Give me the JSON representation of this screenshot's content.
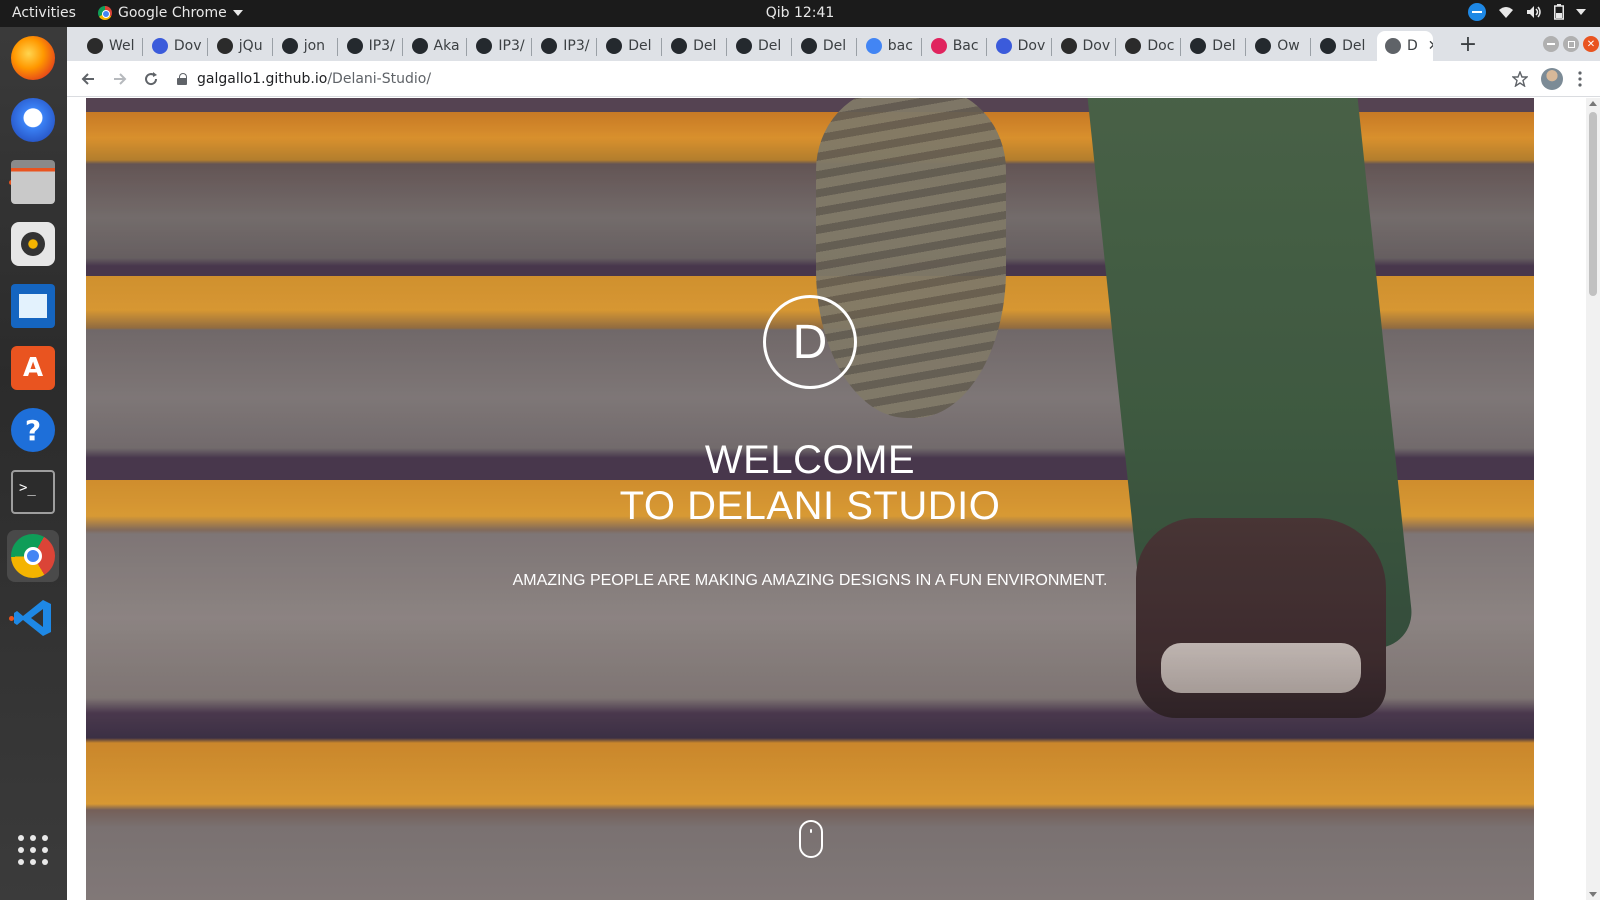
{
  "system": {
    "activities": "Activities",
    "app_menu": "Google Chrome",
    "clock": "Qib 12:41"
  },
  "dock": {
    "apps": [
      "firefox-icon",
      "thunderbird-icon",
      "files-icon",
      "rhythmbox-icon",
      "writer-icon",
      "software-center-icon",
      "help-icon",
      "terminal-icon",
      "chrome-icon",
      "vscode-icon",
      "show-apps-icon"
    ]
  },
  "tabs": [
    {
      "label": "Wel",
      "favicon": "#2b2b2b"
    },
    {
      "label": "Dov",
      "favicon": "#3b5bdb"
    },
    {
      "label": "jQu",
      "favicon": "#2b2b2b"
    },
    {
      "label": "jon",
      "favicon": "#24292e"
    },
    {
      "label": "IP3/",
      "favicon": "#24292e"
    },
    {
      "label": "Aka",
      "favicon": "#24292e"
    },
    {
      "label": "IP3/",
      "favicon": "#24292e"
    },
    {
      "label": "IP3/",
      "favicon": "#24292e"
    },
    {
      "label": "Del",
      "favicon": "#24292e"
    },
    {
      "label": "Del",
      "favicon": "#24292e"
    },
    {
      "label": "Del",
      "favicon": "#24292e"
    },
    {
      "label": "Del",
      "favicon": "#24292e"
    },
    {
      "label": "bac",
      "favicon": "#4285f4"
    },
    {
      "label": "Bac",
      "favicon": "#e0245e"
    },
    {
      "label": "Dov",
      "favicon": "#3b5bdb"
    },
    {
      "label": "Dov",
      "favicon": "#2b2b2b"
    },
    {
      "label": "Doc",
      "favicon": "#2b2b2b"
    },
    {
      "label": "Del",
      "favicon": "#24292e"
    },
    {
      "label": "Ow",
      "favicon": "#24292e"
    },
    {
      "label": "Del",
      "favicon": "#24292e"
    },
    {
      "label": "D",
      "favicon": "#5f6368",
      "active": true
    }
  ],
  "toolbar": {
    "url_host": "galgallo1.github.io",
    "url_path": "/Delani-Studio/"
  },
  "page": {
    "logo_letter": "D",
    "welcome_line1": "WELCOME",
    "welcome_line2": "TO DELANI STUDIO",
    "tagline": "AMAZING PEOPLE ARE MAKING AMAZING DESIGNS IN A FUN ENVIRONMENT."
  },
  "colors": {
    "accent_orange": "#f4a52a",
    "stair_grey": "#8a867f",
    "ubuntu_orange": "#e95420"
  }
}
